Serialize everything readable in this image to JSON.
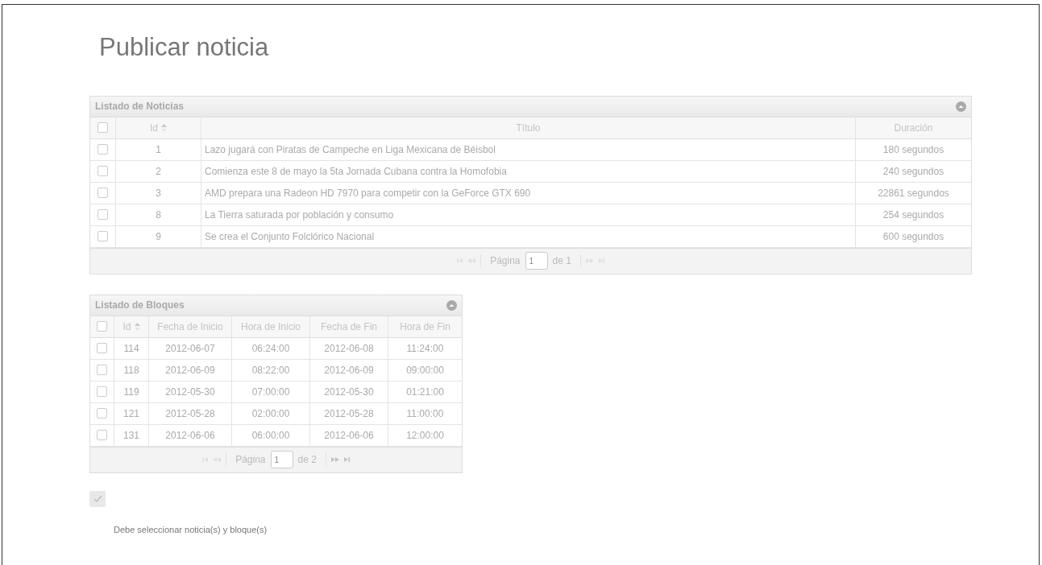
{
  "title": "Publicar noticia",
  "news_grid": {
    "caption": "Listado de Noticias",
    "columns": [
      {
        "label": "Id",
        "sorted": true
      },
      {
        "label": "Título",
        "sorted": false
      },
      {
        "label": "Duración",
        "sorted": false
      }
    ],
    "select_all": {
      "checked": false
    },
    "rows": [
      {
        "checked": false,
        "id": "1",
        "title": "Lazo jugará con Piratas de Campeche en Liga Mexicana de Béisbol",
        "duration": "180 segundos"
      },
      {
        "checked": false,
        "id": "2",
        "title": "Comienza este 8 de mayo la 5ta Jornada Cubana contra la Homofobia",
        "duration": "240 segundos"
      },
      {
        "checked": false,
        "id": "3",
        "title": "AMD prepara una Radeon HD 7970 para competir con la GeForce GTX 690",
        "duration": "22861 segundos"
      },
      {
        "checked": false,
        "id": "8",
        "title": "La Tierra saturada por población y consumo",
        "duration": "254 segundos"
      },
      {
        "checked": false,
        "id": "9",
        "title": "Se crea el Conjunto Folclórico Nacional",
        "duration": "600 segundos"
      }
    ],
    "pager": {
      "label": "Página",
      "page": "1",
      "total": "de 1",
      "first_disabled": true,
      "prev_disabled": true,
      "next_disabled": true,
      "last_disabled": true
    }
  },
  "blocks_grid": {
    "caption": "Listado de Bloques",
    "columns": [
      {
        "label": "Id",
        "sorted": true
      },
      {
        "label": "Fecha de Inicio",
        "sorted": false
      },
      {
        "label": "Hora de Inicio",
        "sorted": false
      },
      {
        "label": "Fecha de Fin",
        "sorted": false
      },
      {
        "label": "Hora de Fin",
        "sorted": false
      }
    ],
    "select_all": {
      "checked": false
    },
    "rows": [
      {
        "checked": false,
        "cells": [
          "114",
          "2012-06-07",
          "06:24:00",
          "2012-06-08",
          "11:24:00"
        ]
      },
      {
        "checked": false,
        "cells": [
          "118",
          "2012-06-09",
          "08:22:00",
          "2012-06-09",
          "09:00:00"
        ]
      },
      {
        "checked": false,
        "cells": [
          "119",
          "2012-05-30",
          "07:00:00",
          "2012-05-30",
          "01:21:00"
        ]
      },
      {
        "checked": false,
        "cells": [
          "121",
          "2012-05-28",
          "02:00:00",
          "2012-05-28",
          "11:00:00"
        ]
      },
      {
        "checked": false,
        "cells": [
          "131",
          "2012-06-06",
          "06:00:00",
          "2012-06-06",
          "12:00:00"
        ]
      }
    ],
    "pager": {
      "label": "Página",
      "page": "1",
      "total": "de 2",
      "first_disabled": true,
      "prev_disabled": true,
      "next_disabled": false,
      "last_disabled": false
    }
  },
  "confirm_button": {
    "disabled": true
  },
  "message": "Debe seleccionar noticia(s) y bloque(s)"
}
